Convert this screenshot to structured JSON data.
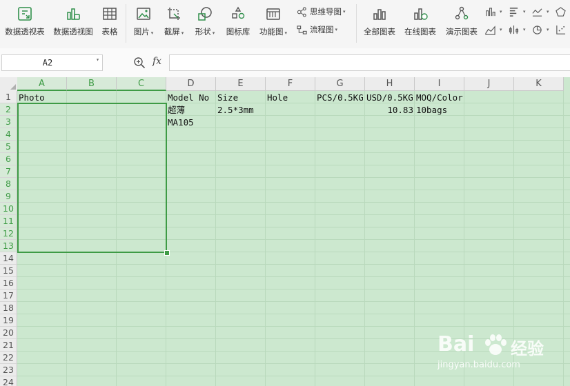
{
  "ribbon": {
    "large_buttons": [
      {
        "label": "数据透视表",
        "icon": "pivot-table-icon"
      },
      {
        "label": "数据透视图",
        "icon": "pivot-chart-icon"
      },
      {
        "label": "表格",
        "icon": "table-icon"
      },
      {
        "label": "图片",
        "icon": "picture-icon"
      },
      {
        "label": "截屏",
        "icon": "screenshot-icon"
      },
      {
        "label": "形状",
        "icon": "shapes-icon"
      },
      {
        "label": "图标库",
        "icon": "icon-library-icon"
      },
      {
        "label": "功能图",
        "icon": "function-chart-icon"
      },
      {
        "label": "全部图表",
        "icon": "all-charts-icon"
      },
      {
        "label": "在线图表",
        "icon": "online-charts-icon"
      },
      {
        "label": "演示图表",
        "icon": "demo-charts-icon"
      }
    ],
    "small_buttons": [
      {
        "label": "思维导图",
        "icon": "mind-map-icon"
      },
      {
        "label": "流程图",
        "icon": "flowchart-icon"
      }
    ]
  },
  "formula_bar": {
    "name_box": "A2",
    "fx_label": "fx",
    "formula": ""
  },
  "sheet": {
    "columns": [
      "A",
      "B",
      "C",
      "D",
      "E",
      "F",
      "G",
      "H",
      "I",
      "J",
      "K"
    ],
    "rows": [
      "1",
      "2",
      "3",
      "4",
      "5",
      "6",
      "7",
      "8",
      "9",
      "10",
      "11",
      "12",
      "13",
      "14",
      "15",
      "16",
      "17",
      "18",
      "19",
      "20",
      "21",
      "22",
      "23",
      "24"
    ],
    "cells": {
      "A1": "Photo",
      "D1": "Model No",
      "E1": "Size",
      "F1": "Hole",
      "G1": "PCS/0.5KG",
      "H1": "USD/0.5KG",
      "I1": "MOQ/Color",
      "D2": "超薄",
      "E2": "2.5*3mm",
      "H2": "10.83",
      "I2": "10bags",
      "D3": "MA105"
    },
    "selected_columns": [
      "A",
      "B",
      "C"
    ],
    "selected_rows": [
      "2",
      "3",
      "4",
      "5",
      "6",
      "7",
      "8",
      "9",
      "10",
      "11",
      "12",
      "13"
    ],
    "background_color": "#cce8cf",
    "selection_color": "#3e9b45"
  },
  "watermark": {
    "brand": "Bai",
    "suffix": "经验",
    "url": "jingyan.baidu.com"
  }
}
